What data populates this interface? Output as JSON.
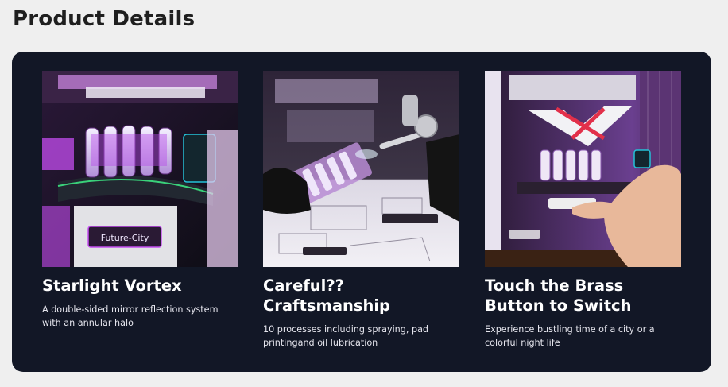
{
  "page": {
    "title": "Product Details"
  },
  "colors": {
    "background": "#efefef",
    "panel": "#121726",
    "accent_purple": "#c44cf0",
    "accent_green": "#3ad17a"
  },
  "cards": [
    {
      "title": "Starlight Vortex",
      "description": "A double-sided mirror reflection system with an annular halo",
      "image_caption": "Future-City"
    },
    {
      "title": "Careful?? Craftsmanship",
      "description": "10 processes including spraying, pad printingand oil lubrication"
    },
    {
      "title": "Touch the Brass Button to Switch",
      "description": "Experience bustling time of a city or a colorful night life"
    }
  ]
}
